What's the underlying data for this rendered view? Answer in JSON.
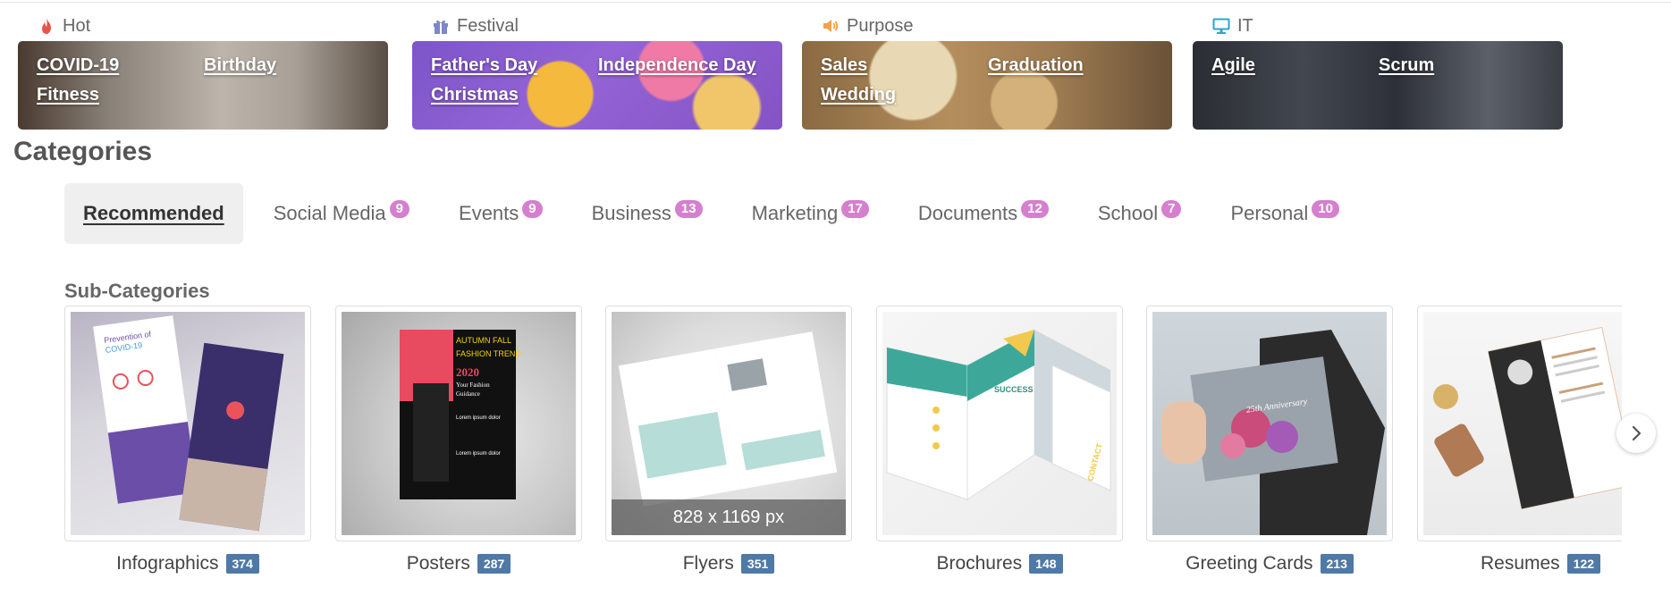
{
  "themes": [
    {
      "name": "Hot",
      "icon": "flame-icon",
      "links": [
        "COVID-19",
        "Birthday",
        "Fitness"
      ]
    },
    {
      "name": "Festival",
      "icon": "gift-icon",
      "links": [
        "Father's Day",
        "Independence Day",
        "Christmas"
      ]
    },
    {
      "name": "Purpose",
      "icon": "speaker-icon",
      "links": [
        "Sales",
        "Graduation",
        "Wedding"
      ]
    },
    {
      "name": "IT",
      "icon": "monitor-icon",
      "links": [
        "Agile",
        "Scrum"
      ]
    }
  ],
  "categories": {
    "title": "Categories",
    "tabs": [
      {
        "label": "Recommended",
        "count": ""
      },
      {
        "label": "Social Media",
        "count": "9"
      },
      {
        "label": "Events",
        "count": "9"
      },
      {
        "label": "Business",
        "count": "13"
      },
      {
        "label": "Marketing",
        "count": "17"
      },
      {
        "label": "Documents",
        "count": "12"
      },
      {
        "label": "School",
        "count": "7"
      },
      {
        "label": "Personal",
        "count": "10"
      }
    ]
  },
  "subcategories": {
    "title": "Sub-Categories",
    "items": [
      {
        "label": "Infographics",
        "count": "374"
      },
      {
        "label": "Posters",
        "count": "287"
      },
      {
        "label": "Flyers",
        "count": "351",
        "dimension": "828 x 1169 px"
      },
      {
        "label": "Brochures",
        "count": "148"
      },
      {
        "label": "Greeting Cards",
        "count": "213"
      },
      {
        "label": "Resumes",
        "count": "122"
      }
    ]
  },
  "thumbnail_text": {
    "infographic": [
      "Prevention of",
      "COVID-19"
    ],
    "poster": [
      "AUTUMN FALL",
      "FASHION TREND",
      "2020",
      "Your Fashion",
      "Guidance",
      "Lorem ipsum dolor",
      "Lorem ipsum dolor"
    ],
    "brochure": [
      "SUCCESS",
      "CONTACT"
    ],
    "greeting": [
      "25th Anniversary"
    ]
  },
  "colors": {
    "tab_badge": "#d57fce",
    "count_badge": "#4f79a6",
    "hot_icon": "#e8544a",
    "festival_icon": "#7d87c9",
    "purpose_icon": "#f2a24a",
    "it_icon": "#2ea6c9"
  }
}
